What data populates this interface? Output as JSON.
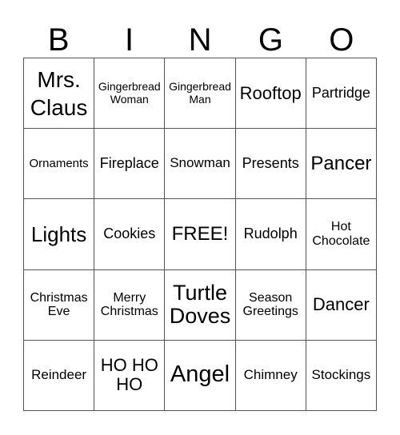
{
  "header": {
    "letters": [
      "B",
      "I",
      "N",
      "G",
      "O"
    ]
  },
  "card": {
    "rows": [
      [
        "Mrs.\nClaus",
        "Gingerbread\nWoman",
        "Gingerbread\nMan",
        "Rooftop",
        "Partridge"
      ],
      [
        "Ornaments",
        "Fireplace",
        "Snowman",
        "Presents",
        "Pancer"
      ],
      [
        "Lights",
        "Cookies",
        "FREE!",
        "Rudolph",
        "Hot\nChocolate"
      ],
      [
        "Christmas\nEve",
        "Merry\nChristmas",
        "Turtle\nDoves",
        "Season\nGreetings",
        "Dancer"
      ],
      [
        "Reindeer",
        "HO HO\nHO",
        "Angel",
        "Chimney",
        "Stockings"
      ]
    ]
  }
}
